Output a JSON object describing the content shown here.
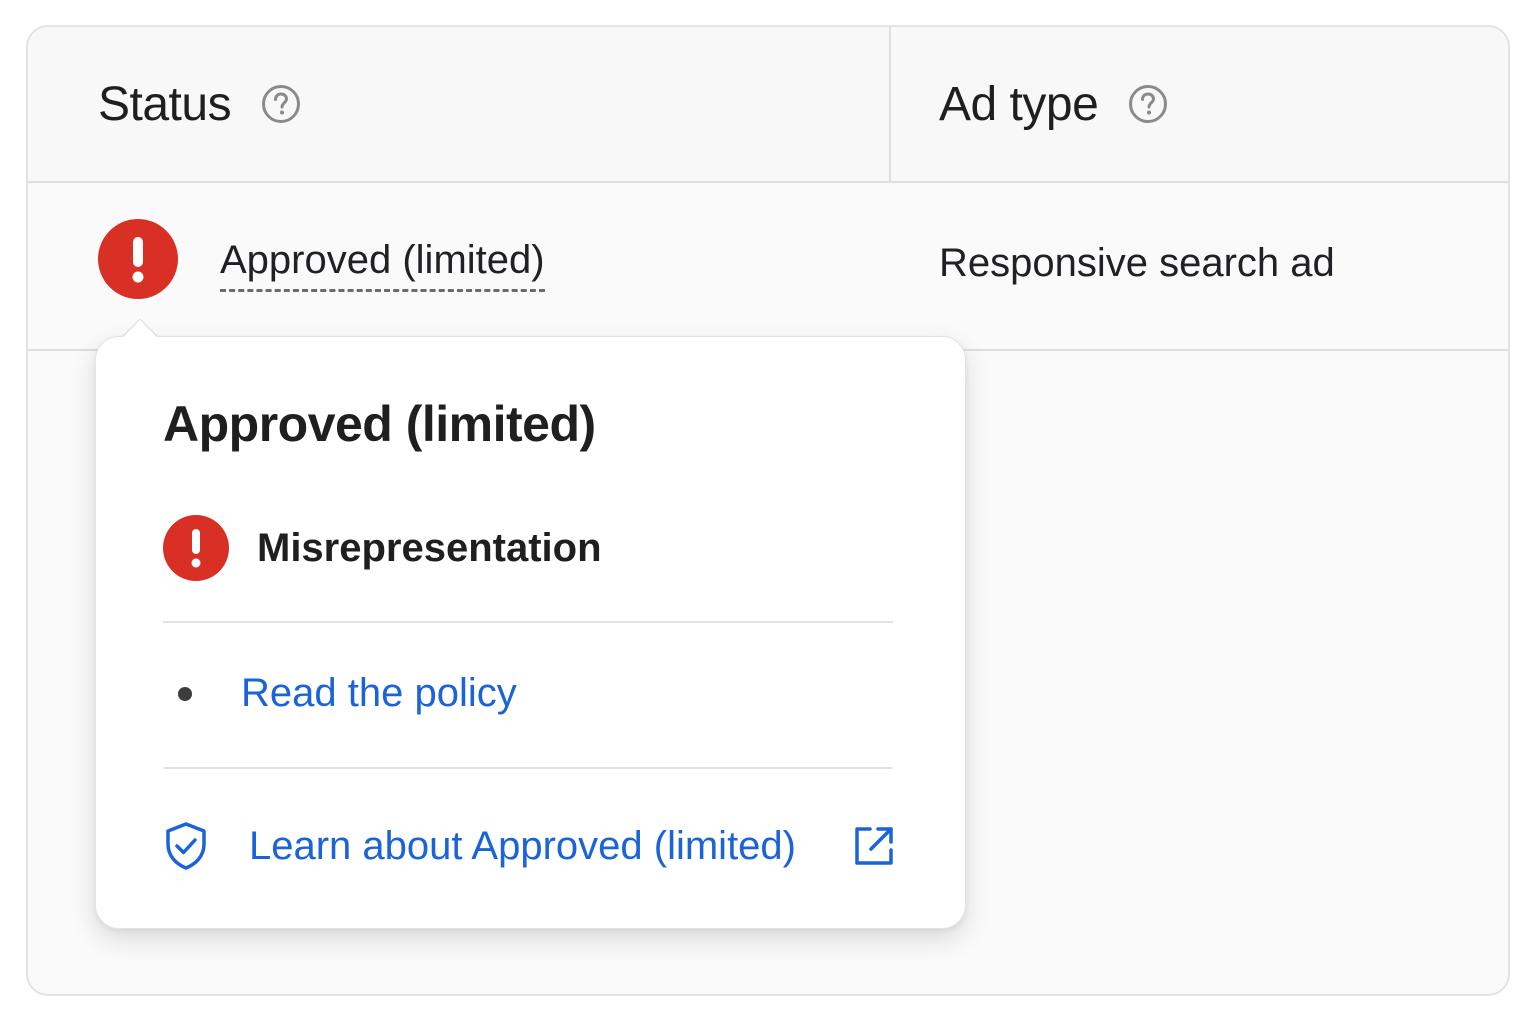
{
  "table": {
    "columns": [
      {
        "label": "Status"
      },
      {
        "label": "Ad type"
      }
    ],
    "rows": [
      {
        "status": "Approved (limited)",
        "ad_type": "Responsive search ad"
      }
    ]
  },
  "popover": {
    "title": "Approved (limited)",
    "issue": "Misrepresentation",
    "policy_link": "Read the policy",
    "learn_link": "Learn about Approved (limited)"
  },
  "colors": {
    "error_red": "#d93025",
    "link_blue": "#1a63d8",
    "help_gray": "#8a8a8a"
  },
  "icons": [
    "help-icon",
    "error-icon",
    "shield-check-icon",
    "open-in-new-icon"
  ]
}
